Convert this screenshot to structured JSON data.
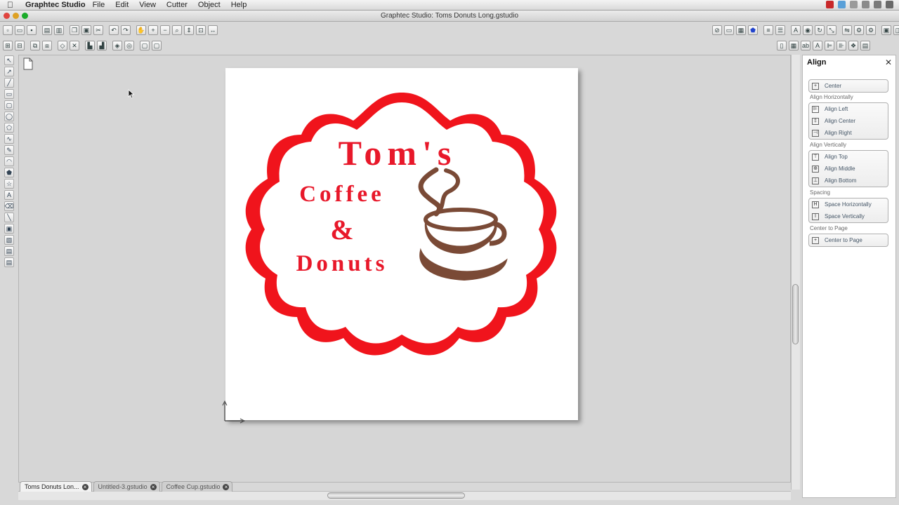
{
  "menubar": {
    "app_name": "Graphtec Studio",
    "items": [
      "File",
      "Edit",
      "View",
      "Cutter",
      "Object",
      "Help"
    ]
  },
  "window": {
    "title": "Graphtec Studio: Toms Donuts Long.gstudio"
  },
  "design": {
    "line1": "Tom's",
    "line2": "Coffee",
    "line3": "&",
    "line4": "Donuts",
    "colors": {
      "red": "#f0141c",
      "brown": "#7a4a36"
    }
  },
  "tabs": [
    {
      "label": "Toms Donuts Lon..."
    },
    {
      "label": "Untitled-3.gstudio"
    },
    {
      "label": "Coffee Cup.gstudio"
    }
  ],
  "align_panel": {
    "title": "Align",
    "center": "Center",
    "sections": {
      "horizontal": "Align Horizontally",
      "vertical": "Align Vertically",
      "spacing": "Spacing",
      "page": "Center to Page"
    },
    "buttons": {
      "align_left": "Align Left",
      "align_center": "Align Center",
      "align_right": "Align Right",
      "align_top": "Align Top",
      "align_middle": "Align Middle",
      "align_bottom": "Align Bottom",
      "space_h": "Space Horizontally",
      "space_v": "Space Vertically",
      "center_page": "Center to Page"
    }
  }
}
